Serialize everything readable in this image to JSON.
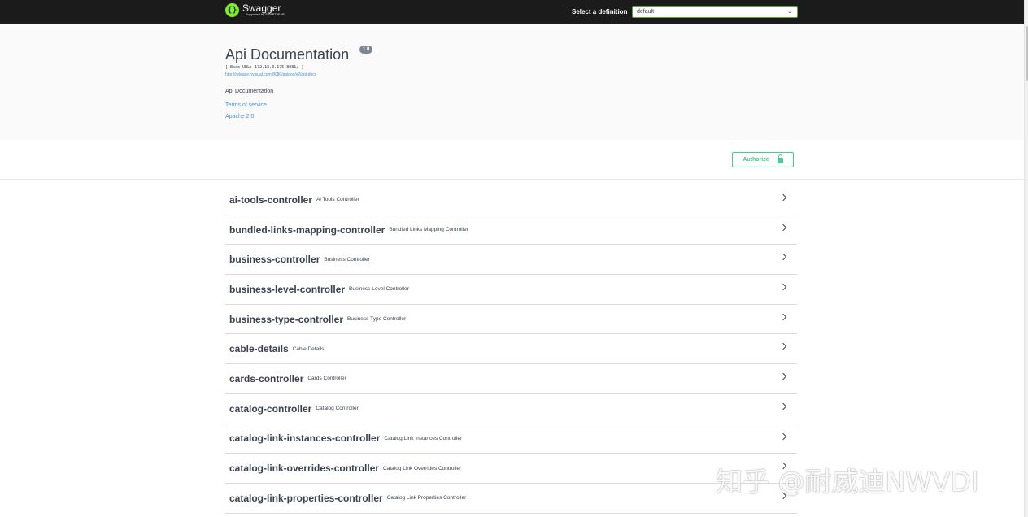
{
  "header": {
    "logo_name": "Swagger",
    "logo_sub": "Supported by SMARTBEAR",
    "definition_label": "Select a definition",
    "definition_value": "default"
  },
  "info": {
    "title": "Api Documentation",
    "version": "1.0",
    "base_url": "[ Base URL: 172.18.0.175:8081/ ]",
    "api_docs_link": "http://release.nvisual.com:8080/apidoc/v2/api-docs",
    "description": "Api Documentation",
    "terms": "Terms of service",
    "license": "Apache 2.0"
  },
  "auth": {
    "label": "Authorize"
  },
  "controllers": [
    {
      "name": "ai-tools-controller",
      "desc": "Ai Tools Controller"
    },
    {
      "name": "bundled-links-mapping-controller",
      "desc": "Bundled Links Mapping Controller"
    },
    {
      "name": "business-controller",
      "desc": "Business Controller"
    },
    {
      "name": "business-level-controller",
      "desc": "Business Level Controller"
    },
    {
      "name": "business-type-controller",
      "desc": "Business Type Controller"
    },
    {
      "name": "cable-details",
      "desc": "Cable Details"
    },
    {
      "name": "cards-controller",
      "desc": "Cards Controller"
    },
    {
      "name": "catalog-controller",
      "desc": "Catalog Controller"
    },
    {
      "name": "catalog-link-instances-controller",
      "desc": "Catalog Link Instances Controller"
    },
    {
      "name": "catalog-link-overrides-controller",
      "desc": "Catalog Link Overrides Controller"
    },
    {
      "name": "catalog-link-properties-controller",
      "desc": "Catalog Link Properties Controller"
    }
  ],
  "watermark": "知乎 @耐威迪NWVDI",
  "colors": {
    "topbar": "#1b1b1b",
    "brand_green": "#85ea2d",
    "authorize_green": "#49cc90",
    "link_blue": "#4990e2",
    "text": "#3b4151"
  }
}
